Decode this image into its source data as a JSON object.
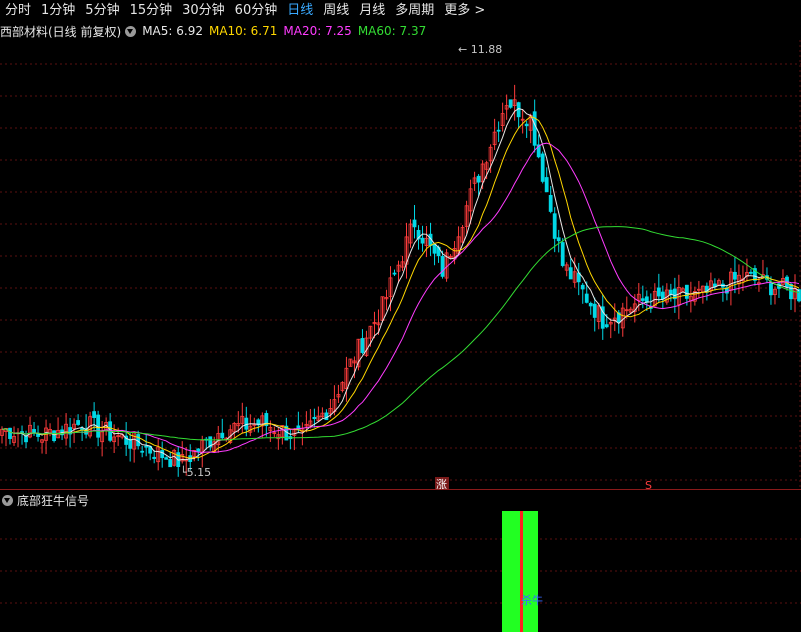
{
  "toolbar": {
    "tabs": [
      {
        "label": "分时"
      },
      {
        "label": "1分钟"
      },
      {
        "label": "5分钟"
      },
      {
        "label": "15分钟"
      },
      {
        "label": "30分钟"
      },
      {
        "label": "60分钟"
      },
      {
        "label": "日线",
        "active": true
      },
      {
        "label": "周线"
      },
      {
        "label": "月线"
      },
      {
        "label": "多周期"
      },
      {
        "label": "更多 >"
      }
    ]
  },
  "legend": {
    "title": "西部材料(日线 前复权)",
    "ma": [
      {
        "label": "MA5: 6.92",
        "color": "#e8e8e8"
      },
      {
        "label": "MA10: 6.71",
        "color": "#ffd700"
      },
      {
        "label": "MA20: 7.25",
        "color": "#ff3cff"
      },
      {
        "label": "MA60: 7.37",
        "color": "#33dd33"
      }
    ]
  },
  "colors": {
    "up": "#ff3c3c",
    "down": "#00d8e6",
    "grid": "#5a0f0f",
    "text": "#c8c8c8"
  },
  "price_axis": {
    "min": 4.9,
    "max": 12.1
  },
  "annotations": {
    "high_label": "11.88",
    "low_label": "5.15",
    "marker_zhang": "涨",
    "marker_s": "S"
  },
  "indicator": {
    "title": "底部狂牛信号",
    "signal_label": "杀牛"
  },
  "chart_data": {
    "type": "candlestick",
    "count": 200,
    "high": 11.88,
    "low": 5.15,
    "ma_values": {
      "MA5": 6.92,
      "MA10": 6.71,
      "MA20": 7.25,
      "MA60": 7.37
    }
  }
}
